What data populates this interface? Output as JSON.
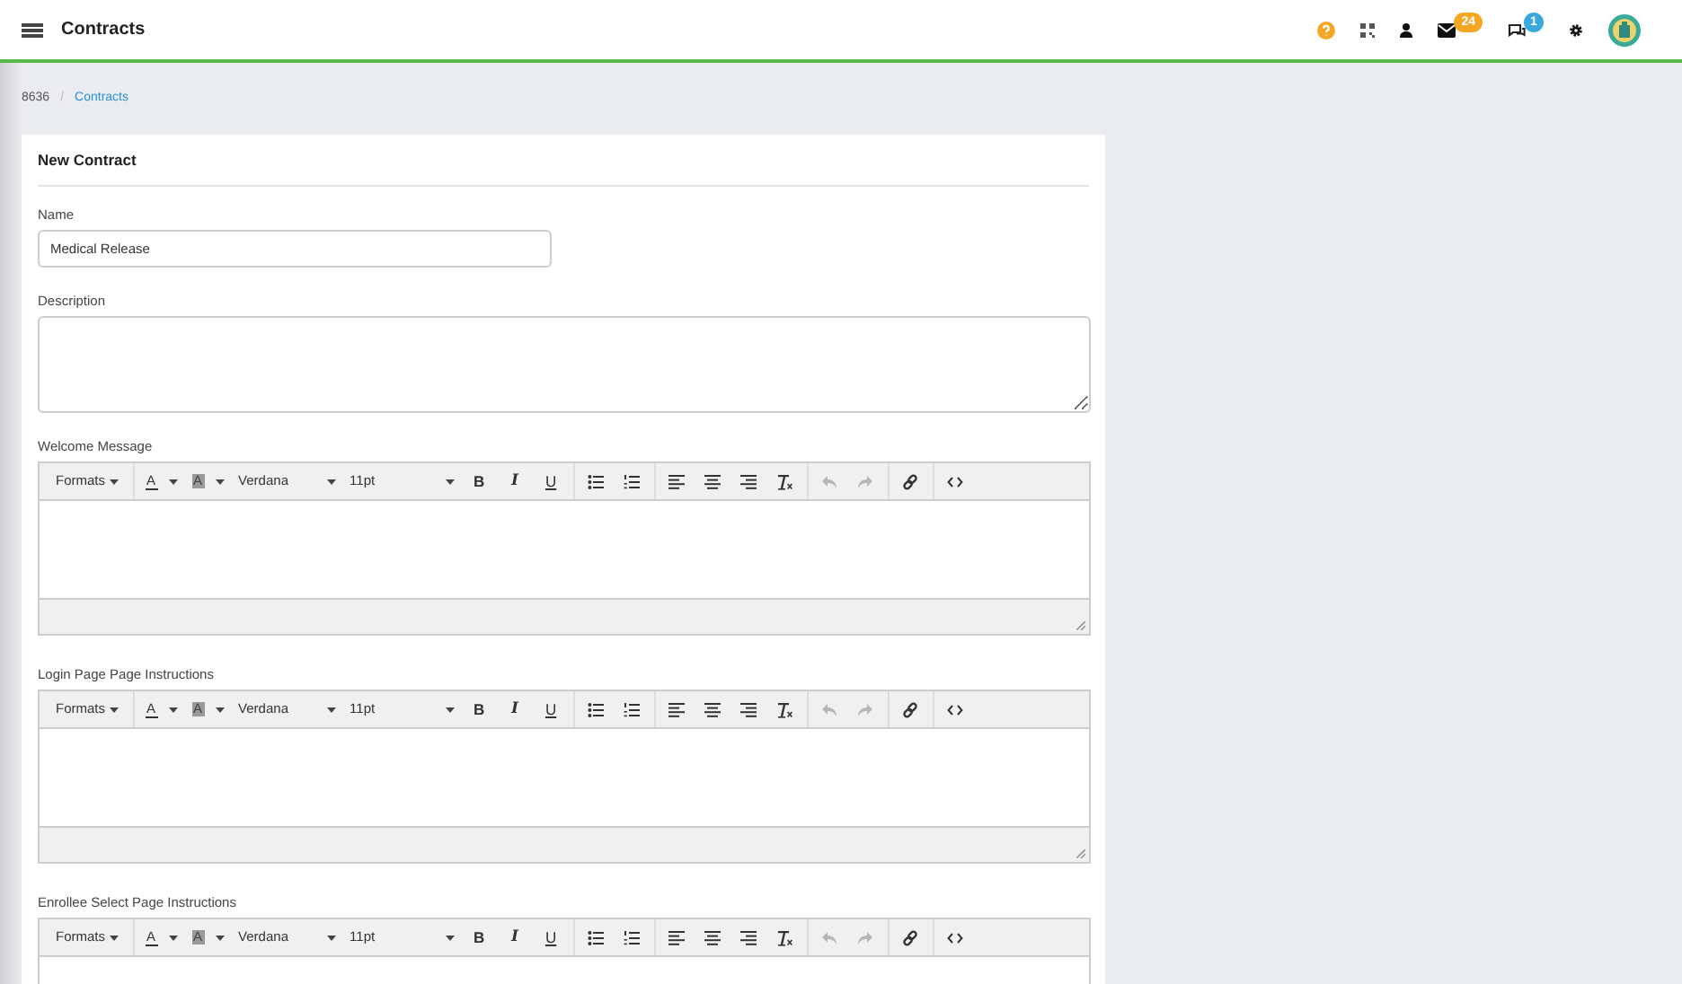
{
  "header": {
    "title": "Contracts",
    "mail_count": "24",
    "chat_count": "1"
  },
  "breadcrumb": {
    "separator": "/",
    "items": [
      {
        "text": "8636",
        "link": false
      },
      {
        "text": "Contracts",
        "link": true
      }
    ]
  },
  "form": {
    "title": "New Contract",
    "fields": [
      {
        "kind": "input",
        "label": "Name",
        "value": "Medical Release"
      },
      {
        "kind": "textarea",
        "label": "Description"
      }
    ],
    "editors": [
      {
        "label": "Welcome Message",
        "status_bar": true,
        "toolbar": [
          [
            {
              "kind": "menu",
              "text": "Formats",
              "disabled": false
            }
          ],
          [
            {
              "kind": "color",
              "text": "A",
              "disabled": false
            },
            {
              "kind": "highlight",
              "text": "A",
              "disabled": false
            },
            {
              "kind": "font",
              "text": "Verdana",
              "disabled": false
            },
            {
              "kind": "size",
              "text": "11pt",
              "disabled": false
            },
            {
              "kind": "bold",
              "text": "B",
              "disabled": false
            },
            {
              "kind": "italic",
              "text": "I",
              "disabled": false
            },
            {
              "kind": "underline",
              "text": "U",
              "disabled": false
            }
          ],
          [
            {
              "kind": "bullets",
              "disabled": false
            },
            {
              "kind": "numbers",
              "disabled": false
            }
          ],
          [
            {
              "kind": "align_left",
              "disabled": false
            },
            {
              "kind": "align_center",
              "disabled": false
            },
            {
              "kind": "align_right",
              "disabled": false
            },
            {
              "kind": "clear",
              "disabled": false
            }
          ],
          [
            {
              "kind": "undo",
              "disabled": true
            },
            {
              "kind": "redo",
              "disabled": true
            }
          ],
          [
            {
              "kind": "link",
              "disabled": false
            }
          ],
          [
            {
              "kind": "code",
              "disabled": false
            }
          ]
        ]
      },
      {
        "label": "Login Page Page Instructions",
        "status_bar": true,
        "toolbar": [
          [
            {
              "kind": "menu",
              "text": "Formats",
              "disabled": false
            }
          ],
          [
            {
              "kind": "color",
              "text": "A",
              "disabled": false
            },
            {
              "kind": "highlight",
              "text": "A",
              "disabled": false
            },
            {
              "kind": "font",
              "text": "Verdana",
              "disabled": false
            },
            {
              "kind": "size",
              "text": "11pt",
              "disabled": false
            },
            {
              "kind": "bold",
              "text": "B",
              "disabled": false
            },
            {
              "kind": "italic",
              "text": "I",
              "disabled": false
            },
            {
              "kind": "underline",
              "text": "U",
              "disabled": false
            }
          ],
          [
            {
              "kind": "bullets",
              "disabled": false
            },
            {
              "kind": "numbers",
              "disabled": false
            }
          ],
          [
            {
              "kind": "align_left",
              "disabled": false
            },
            {
              "kind": "align_center",
              "disabled": false
            },
            {
              "kind": "align_right",
              "disabled": false
            },
            {
              "kind": "clear",
              "disabled": false
            }
          ],
          [
            {
              "kind": "undo",
              "disabled": true
            },
            {
              "kind": "redo",
              "disabled": true
            }
          ],
          [
            {
              "kind": "link",
              "disabled": false
            }
          ],
          [
            {
              "kind": "code",
              "disabled": false
            }
          ]
        ]
      },
      {
        "label": "Enrollee Select Page Instructions",
        "toolbar": [
          [
            {
              "kind": "menu",
              "text": "Formats",
              "disabled": false
            }
          ],
          [
            {
              "kind": "color",
              "text": "A",
              "disabled": false
            },
            {
              "kind": "highlight",
              "text": "A",
              "disabled": false
            },
            {
              "kind": "font",
              "text": "Verdana",
              "disabled": false
            },
            {
              "kind": "size",
              "text": "11pt",
              "disabled": false
            },
            {
              "kind": "bold",
              "text": "B",
              "disabled": false
            },
            {
              "kind": "italic",
              "text": "I",
              "disabled": false
            },
            {
              "kind": "underline",
              "text": "U",
              "disabled": false
            }
          ],
          [
            {
              "kind": "bullets",
              "disabled": false
            },
            {
              "kind": "numbers",
              "disabled": false
            }
          ],
          [
            {
              "kind": "align_left",
              "disabled": false
            },
            {
              "kind": "align_center",
              "disabled": false
            },
            {
              "kind": "align_right",
              "disabled": false
            },
            {
              "kind": "clear",
              "disabled": false
            }
          ],
          [
            {
              "kind": "undo",
              "disabled": true
            },
            {
              "kind": "redo",
              "disabled": true
            }
          ],
          [
            {
              "kind": "link",
              "disabled": false
            }
          ],
          [
            {
              "kind": "code",
              "disabled": false
            }
          ]
        ]
      }
    ]
  }
}
